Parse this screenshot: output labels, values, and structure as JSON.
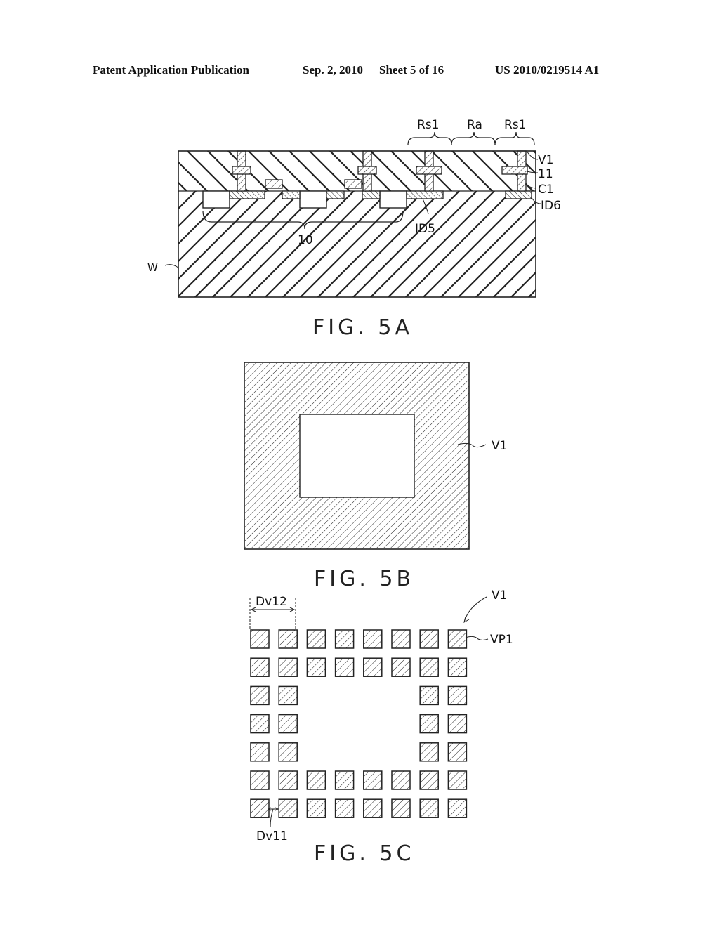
{
  "header": {
    "publication": "Patent Application Publication",
    "date": "Sep. 2, 2010",
    "sheet": "Sheet 5 of 16",
    "number": "US 2010/0219514 A1"
  },
  "fig5a": {
    "caption": "FIG. 5A",
    "labels": {
      "rs1_left": "Rs1",
      "ra": "Ra",
      "rs1_right": "Rs1",
      "v1": "V1",
      "n11": "11",
      "c1": "C1",
      "id6": "ID6",
      "id5": "ID5",
      "n10": "10",
      "w": "W"
    }
  },
  "fig5b": {
    "caption": "FIG. 5B",
    "labels": {
      "v1": "V1"
    }
  },
  "fig5c": {
    "caption": "FIG. 5C",
    "labels": {
      "v1": "V1",
      "vp1": "VP1",
      "dv12": "Dv12",
      "dv11": "Dv11"
    },
    "grid": {
      "rows": 7,
      "cols": 8,
      "pattern": [
        [
          1,
          1,
          1,
          1,
          1,
          1,
          1,
          1
        ],
        [
          1,
          1,
          1,
          1,
          1,
          1,
          1,
          1
        ],
        [
          1,
          1,
          0,
          0,
          0,
          0,
          1,
          1
        ],
        [
          1,
          1,
          0,
          0,
          0,
          0,
          1,
          1
        ],
        [
          1,
          1,
          0,
          0,
          0,
          0,
          1,
          1
        ],
        [
          1,
          1,
          1,
          1,
          1,
          1,
          1,
          1
        ],
        [
          1,
          1,
          1,
          1,
          1,
          1,
          1,
          1
        ]
      ]
    }
  }
}
